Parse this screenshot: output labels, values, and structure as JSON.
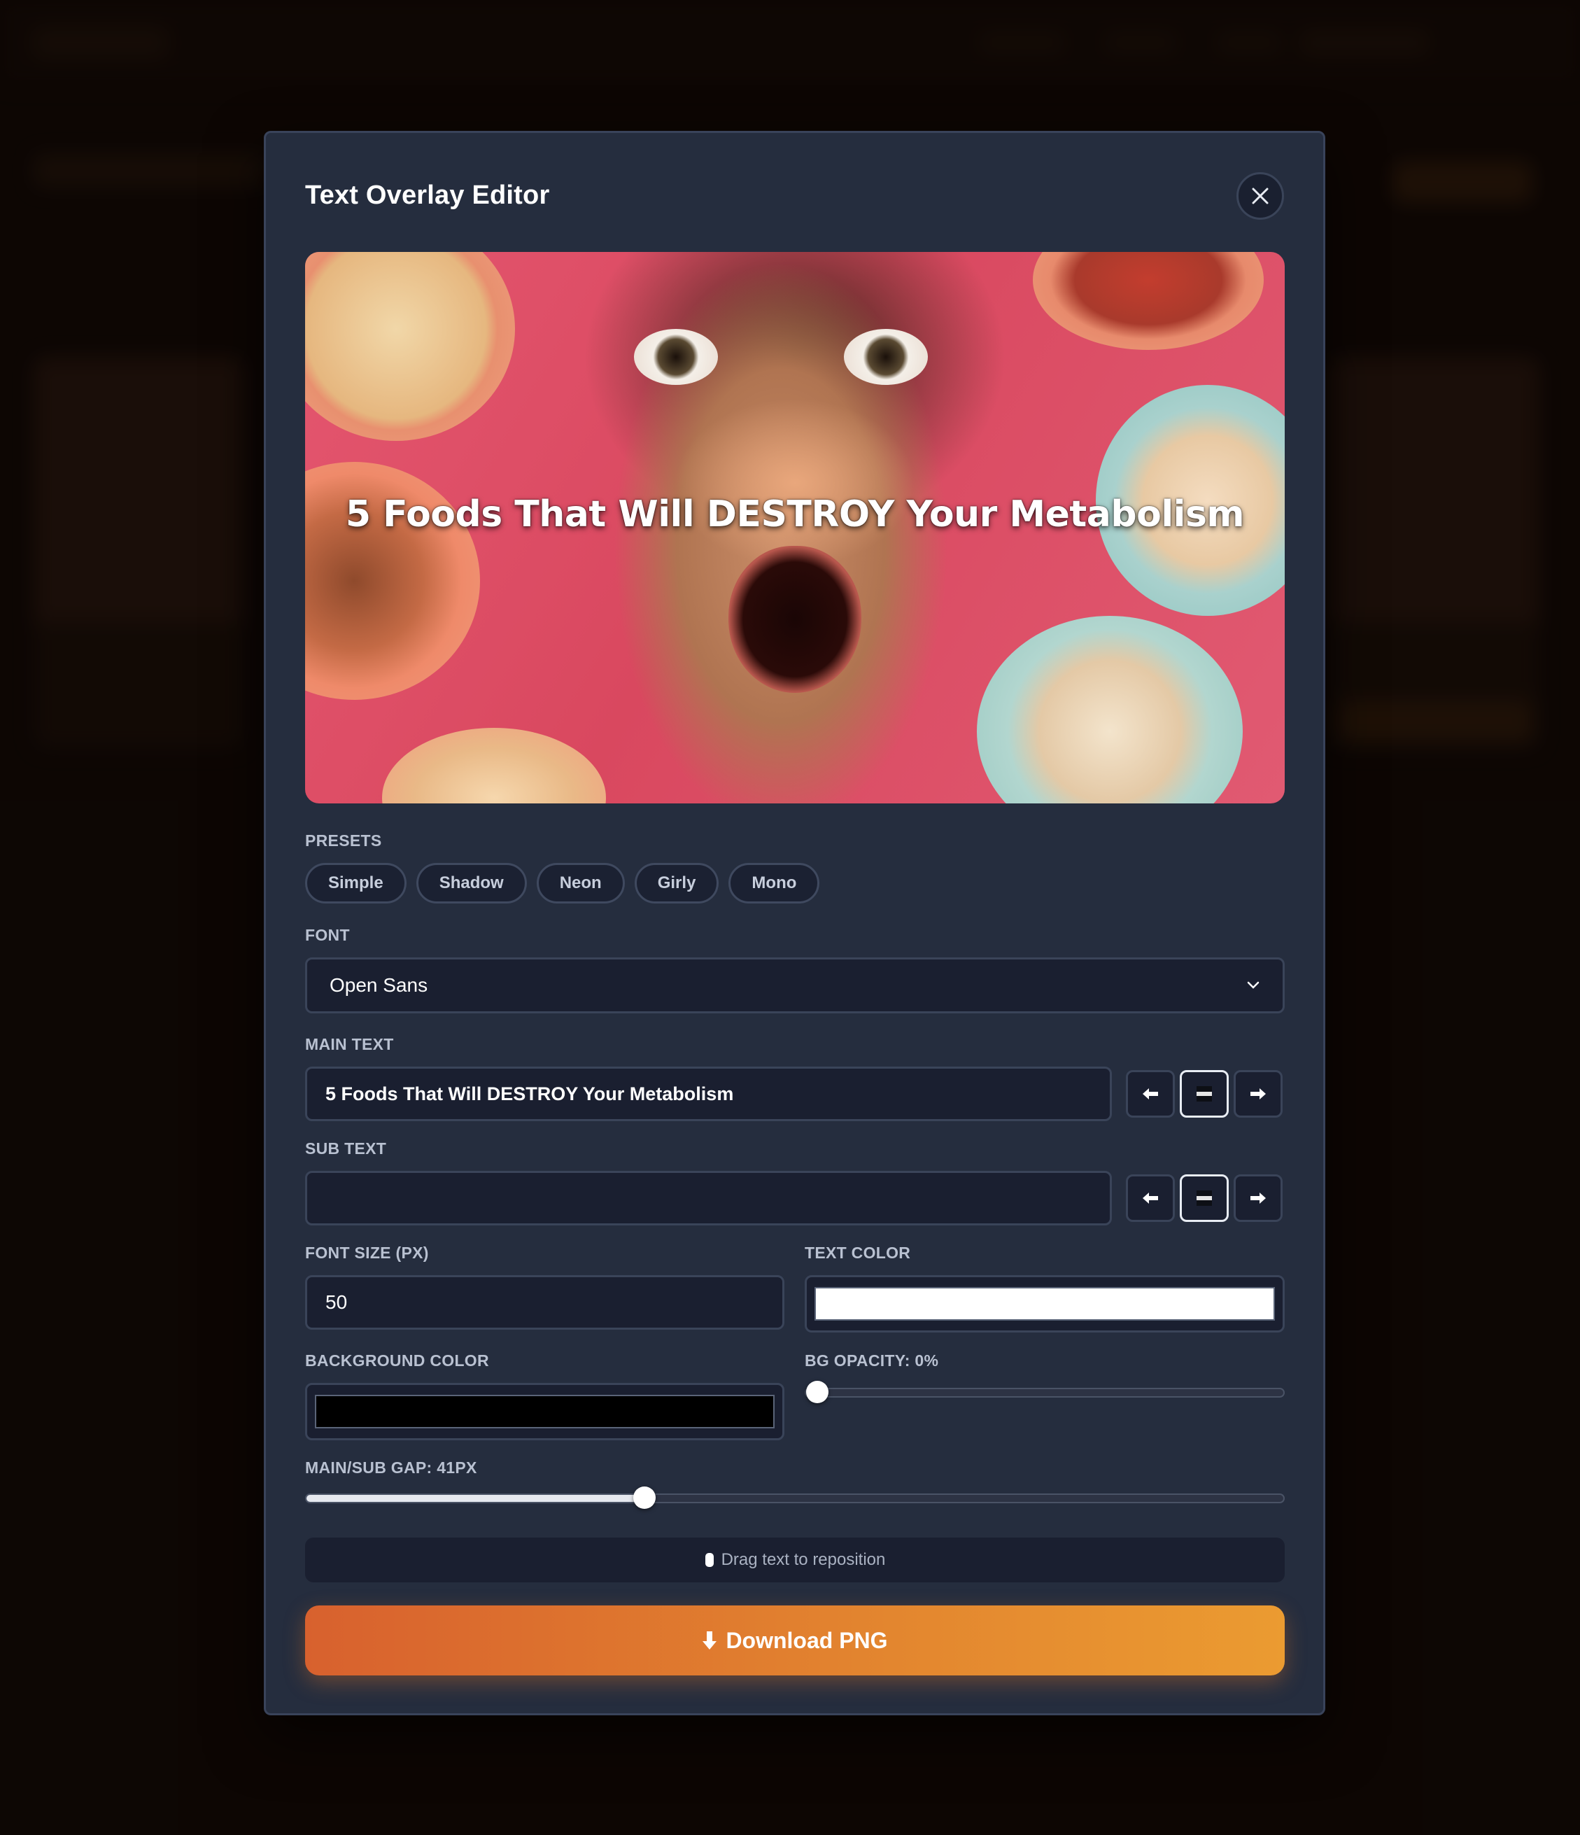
{
  "modal": {
    "title": "Text Overlay Editor"
  },
  "preview": {
    "overlay_text": "5 Foods That Will DESTROY Your Metabolism"
  },
  "presets": {
    "label": "PRESETS",
    "items": [
      "Simple",
      "Shadow",
      "Neon",
      "Girly",
      "Mono"
    ]
  },
  "font": {
    "label": "FONT",
    "selected": "Open Sans"
  },
  "main_text": {
    "label": "MAIN TEXT",
    "value": "5 Foods That Will DESTROY Your Metabolism",
    "align": "center"
  },
  "sub_text": {
    "label": "SUB TEXT",
    "value": "",
    "align": "center"
  },
  "font_size": {
    "label": "FONT SIZE (PX)",
    "value": "50"
  },
  "text_color": {
    "label": "TEXT COLOR",
    "value": "#ffffff"
  },
  "background_color": {
    "label": "BACKGROUND COLOR",
    "value": "#000000"
  },
  "bg_opacity": {
    "label": "BG OPACITY: 0%",
    "value": 0
  },
  "gap": {
    "label": "MAIN/SUB GAP: 41PX",
    "value": 41,
    "fraction": 0.345
  },
  "hint": {
    "text": "Drag text to reposition"
  },
  "download": {
    "label": "Download PNG"
  },
  "colors": {
    "modal_bg": "#252d3e",
    "field_bg": "#1a1f30",
    "accent_start": "#d8612e",
    "accent_end": "#eb9b31"
  }
}
